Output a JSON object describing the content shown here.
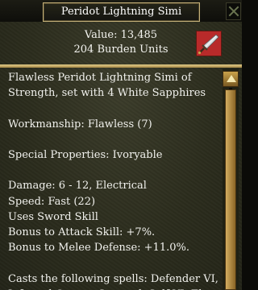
{
  "window": {
    "title": "Peridot Lightning Simi"
  },
  "summary": {
    "value": "Value: 13,485",
    "burden": "204 Burden Units",
    "icon": "sword-icon"
  },
  "description": {
    "lines": [
      "Flawless Peridot Lightning Simi of",
      "Strength, set with 4 White Sapphires",
      "",
      "Workmanship: Flawless (7)",
      "",
      "Special Properties: Ivoryable",
      "",
      "Damage: 6 - 12, Electrical",
      "Speed: Fast (22)",
      "Uses Sword Skill",
      "Bonus to Attack Skill: +7%.",
      "Bonus to Melee Defense: +11.0%.",
      "",
      "Casts the following spells: Defender VI,",
      "Infected Caress, Strength Self VI, Elysa's"
    ]
  },
  "scroll": {
    "position": 0
  }
}
